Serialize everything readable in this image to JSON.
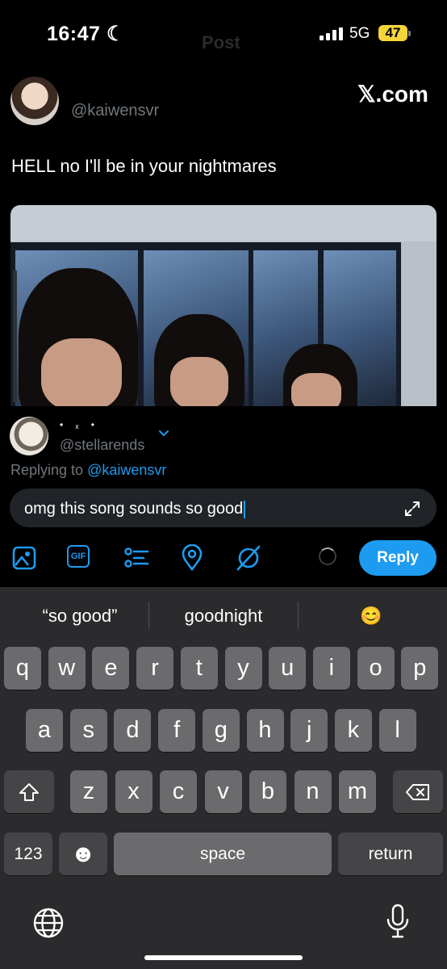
{
  "status_bar": {
    "time": "16:47",
    "network": "5G",
    "battery": "47",
    "ghost_title": "Post"
  },
  "post": {
    "handle": "@kaiwensvr",
    "source": "𝕏.com",
    "text": "HELL no I'll be in your nightmares"
  },
  "reply": {
    "display_name": "• ₓ •",
    "handle": "@stellarends",
    "replying_prefix": "Replying to ",
    "replying_to": "@kaiwensvr",
    "draft_text": "omg this song sounds so good",
    "reply_label": "Reply",
    "tools": [
      "image-icon",
      "gif-icon",
      "poll-icon",
      "location-icon",
      "grok-icon"
    ],
    "gif_label": "GIF"
  },
  "keyboard": {
    "suggestions": [
      "“so good”",
      "goodnight",
      "😊"
    ],
    "row1": [
      "q",
      "w",
      "e",
      "r",
      "t",
      "y",
      "u",
      "i",
      "o",
      "p"
    ],
    "row2": [
      "a",
      "s",
      "d",
      "f",
      "g",
      "h",
      "j",
      "k",
      "l"
    ],
    "row3": [
      "z",
      "x",
      "c",
      "v",
      "b",
      "n",
      "m"
    ],
    "numbers_label": "123",
    "space_label": "space",
    "return_label": "return",
    "emoji_glyph": "☻"
  },
  "colors": {
    "accent": "#1d9bf0",
    "background": "#000000",
    "keyboard": "#2b2b2d",
    "battery": "#f5d43a"
  }
}
